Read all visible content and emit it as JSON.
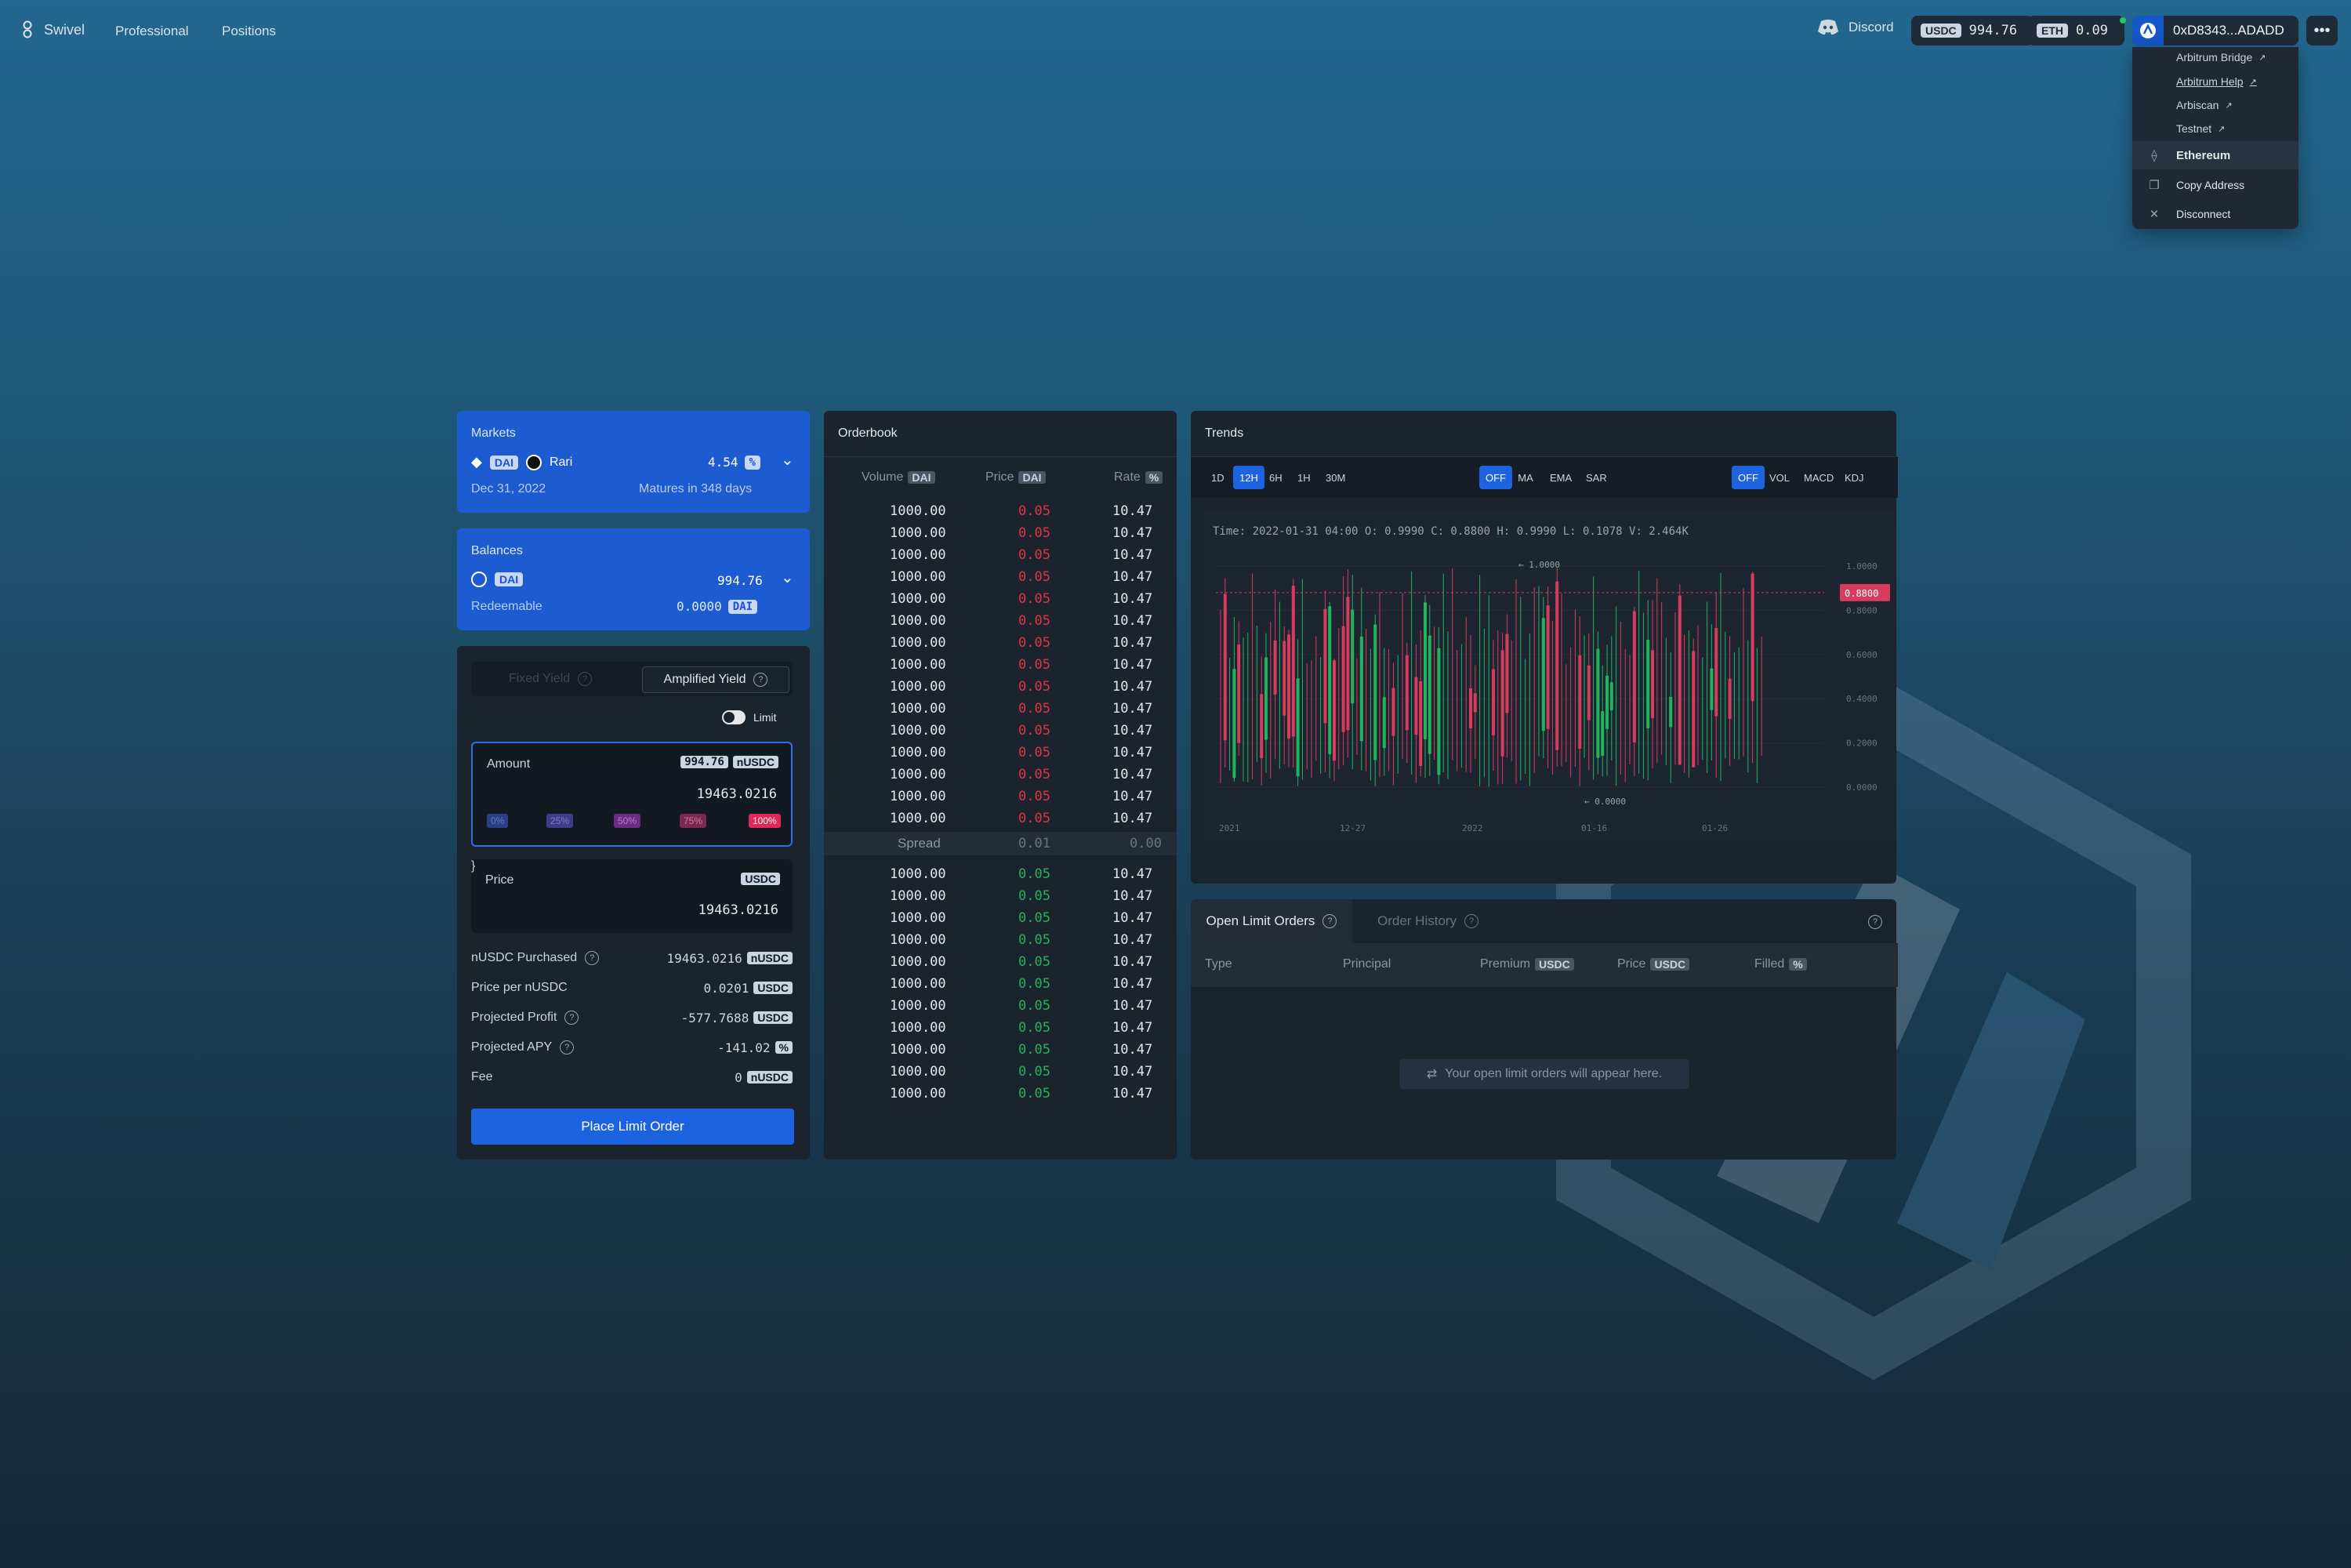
{
  "header": {
    "brand": "Swivel",
    "nav": [
      "Professional",
      "Positions"
    ],
    "discord_label": "Discord",
    "usdc_tag": "USDC",
    "usdc_balance": "994.76",
    "eth_tag": "ETH",
    "eth_balance": "0.09",
    "account": "0xD8343...ADADD"
  },
  "account_menu": {
    "links": [
      "Arbitrum Bridge",
      "Arbitrum Help",
      "Arbiscan",
      "Testnet"
    ],
    "network": "Ethereum",
    "copy_address": "Copy Address",
    "disconnect": "Disconnect"
  },
  "markets": {
    "title": "Markets",
    "asset": "DAI",
    "protocol": "Rari",
    "rate": "4.54",
    "rate_unit": "%",
    "maturity_date": "Dec 31, 2022",
    "matures_in": "Matures in 348 days"
  },
  "balances": {
    "title": "Balances",
    "asset": "DAI",
    "amount": "994.76",
    "redeemable_label": "Redeemable",
    "redeemable_value": "0.0000",
    "redeemable_unit": "DAI"
  },
  "trade": {
    "tab_fixed": "Fixed Yield",
    "tab_amplified": "Amplified Yield",
    "limit_label": "Limit",
    "amount_label": "Amount",
    "amount_max": "994.76",
    "amount_unit": "nUSDC",
    "amount_value": "19463.0216",
    "percents": [
      "0%",
      "25%",
      "50%",
      "75%",
      "100%"
    ],
    "price_label": "Price",
    "price_unit": "USDC",
    "price_value": "19463.0216",
    "summary": [
      {
        "label": "nUSDC Purchased",
        "value": "19463.0216",
        "unit": "nUSDC",
        "help": true
      },
      {
        "label": "Price per nUSDC",
        "value": "0.0201",
        "unit": "USDC",
        "help": false
      },
      {
        "label": "Projected Profit",
        "value": "-577.7688",
        "unit": "USDC",
        "help": true
      },
      {
        "label": "Projected APY",
        "value": "-141.02",
        "unit": "%",
        "help": true
      },
      {
        "label": "Fee",
        "value": "0",
        "unit": "nUSDC",
        "help": false
      }
    ],
    "submit": "Place Limit Order"
  },
  "orderbook": {
    "title": "Orderbook",
    "col_volume": "Volume",
    "col_volume_unit": "DAI",
    "col_price": "Price",
    "col_price_unit": "DAI",
    "col_rate": "Rate",
    "col_rate_unit": "%",
    "asks": [
      [
        "1000.00",
        "0.05",
        "10.47"
      ],
      [
        "1000.00",
        "0.05",
        "10.47"
      ],
      [
        "1000.00",
        "0.05",
        "10.47"
      ],
      [
        "1000.00",
        "0.05",
        "10.47"
      ],
      [
        "1000.00",
        "0.05",
        "10.47"
      ],
      [
        "1000.00",
        "0.05",
        "10.47"
      ],
      [
        "1000.00",
        "0.05",
        "10.47"
      ],
      [
        "1000.00",
        "0.05",
        "10.47"
      ],
      [
        "1000.00",
        "0.05",
        "10.47"
      ],
      [
        "1000.00",
        "0.05",
        "10.47"
      ],
      [
        "1000.00",
        "0.05",
        "10.47"
      ],
      [
        "1000.00",
        "0.05",
        "10.47"
      ],
      [
        "1000.00",
        "0.05",
        "10.47"
      ],
      [
        "1000.00",
        "0.05",
        "10.47"
      ],
      [
        "1000.00",
        "0.05",
        "10.47"
      ]
    ],
    "spread_label": "Spread",
    "spread_price": "0.01",
    "spread_rate": "0.00",
    "bids": [
      [
        "1000.00",
        "0.05",
        "10.47"
      ],
      [
        "1000.00",
        "0.05",
        "10.47"
      ],
      [
        "1000.00",
        "0.05",
        "10.47"
      ],
      [
        "1000.00",
        "0.05",
        "10.47"
      ],
      [
        "1000.00",
        "0.05",
        "10.47"
      ],
      [
        "1000.00",
        "0.05",
        "10.47"
      ],
      [
        "1000.00",
        "0.05",
        "10.47"
      ],
      [
        "1000.00",
        "0.05",
        "10.47"
      ],
      [
        "1000.00",
        "0.05",
        "10.47"
      ],
      [
        "1000.00",
        "0.05",
        "10.47"
      ],
      [
        "1000.00",
        "0.05",
        "10.47"
      ]
    ]
  },
  "trends": {
    "title": "Trends",
    "intervals": [
      "1D",
      "12H",
      "6H",
      "1H",
      "30M"
    ],
    "active_interval": "12H",
    "main_indicators": [
      "OFF",
      "MA",
      "EMA",
      "SAR"
    ],
    "sub_indicators": [
      "OFF",
      "VOL",
      "MACD",
      "KDJ"
    ],
    "info": "Time: 2022-01-31 04:00 O: 0.9990 C: 0.8800 H: 0.9990 L: 0.1078 V: 2.464K",
    "high_marker": "1.0000",
    "low_marker": "0.0000",
    "current_price": "0.8800",
    "y_ticks": [
      "1.0000",
      "0.8000",
      "0.6000",
      "0.4000",
      "0.2000",
      "0.0000"
    ],
    "x_ticks": [
      "2021",
      "12-27",
      "2022",
      "01-16",
      "01-26"
    ]
  },
  "orders": {
    "tab_open": "Open Limit Orders",
    "tab_history": "Order History",
    "col_type": "Type",
    "col_principal": "Principal",
    "col_premium": "Premium",
    "col_premium_unit": "USDC",
    "col_price": "Price",
    "col_price_unit": "USDC",
    "col_filled": "Filled",
    "col_filled_unit": "%",
    "empty_message": "Your open limit orders will appear here."
  },
  "colors": {
    "accent": "#1d63e0",
    "panel": "#1b232d",
    "ask": "#dc3545",
    "bid": "#22b35e"
  }
}
